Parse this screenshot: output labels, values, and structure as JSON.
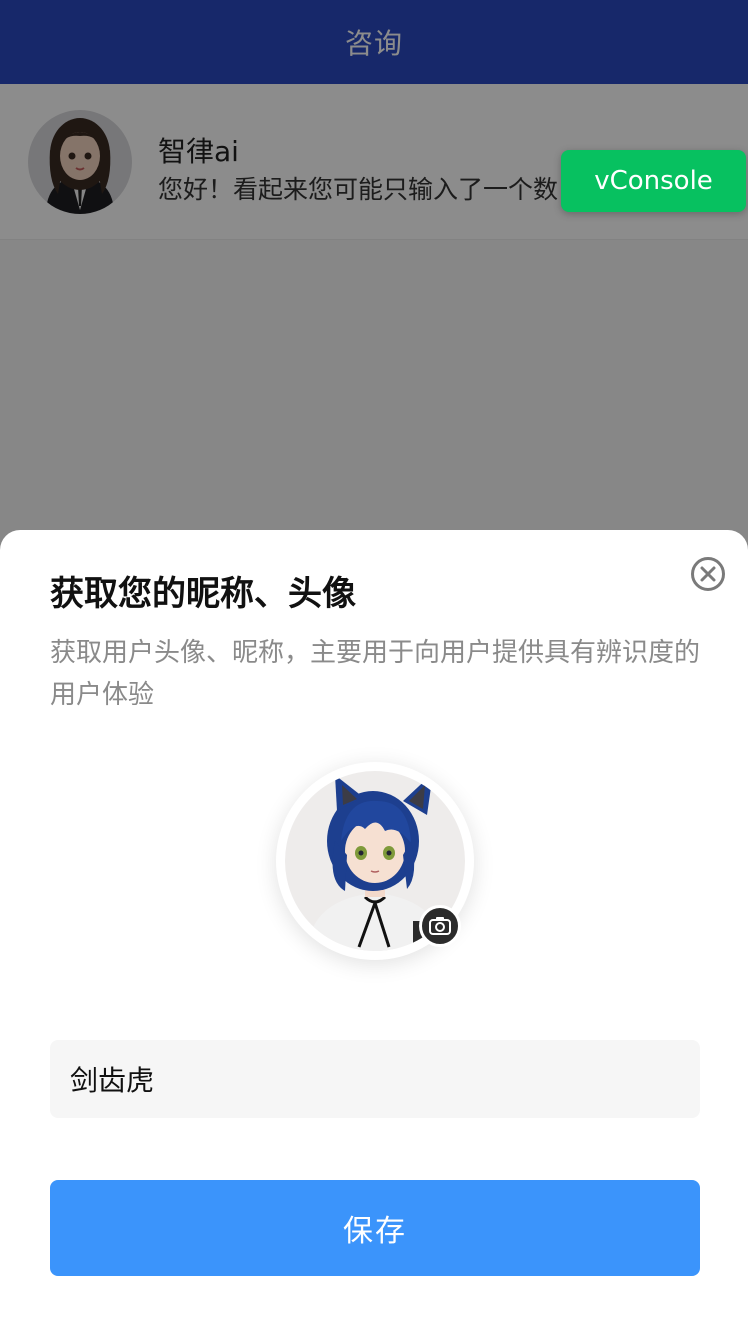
{
  "header": {
    "title": "咨询"
  },
  "chat_list": [
    {
      "name": "智律ai",
      "preview": "您好！看起来您可能只输入了一个数"
    }
  ],
  "debug": {
    "vconsole_label": "vConsole",
    "color": "#07c160"
  },
  "sheet": {
    "title": "获取您的昵称、头像",
    "description": "获取用户头像、昵称，主要用于向用户提供具有辨识度的用户体验",
    "nickname_value": "剑齿虎",
    "save_label": "保存"
  },
  "colors": {
    "header_bg": "#2a49c2",
    "primary_button": "#3b94fb",
    "vconsole_bg": "#07c160"
  }
}
